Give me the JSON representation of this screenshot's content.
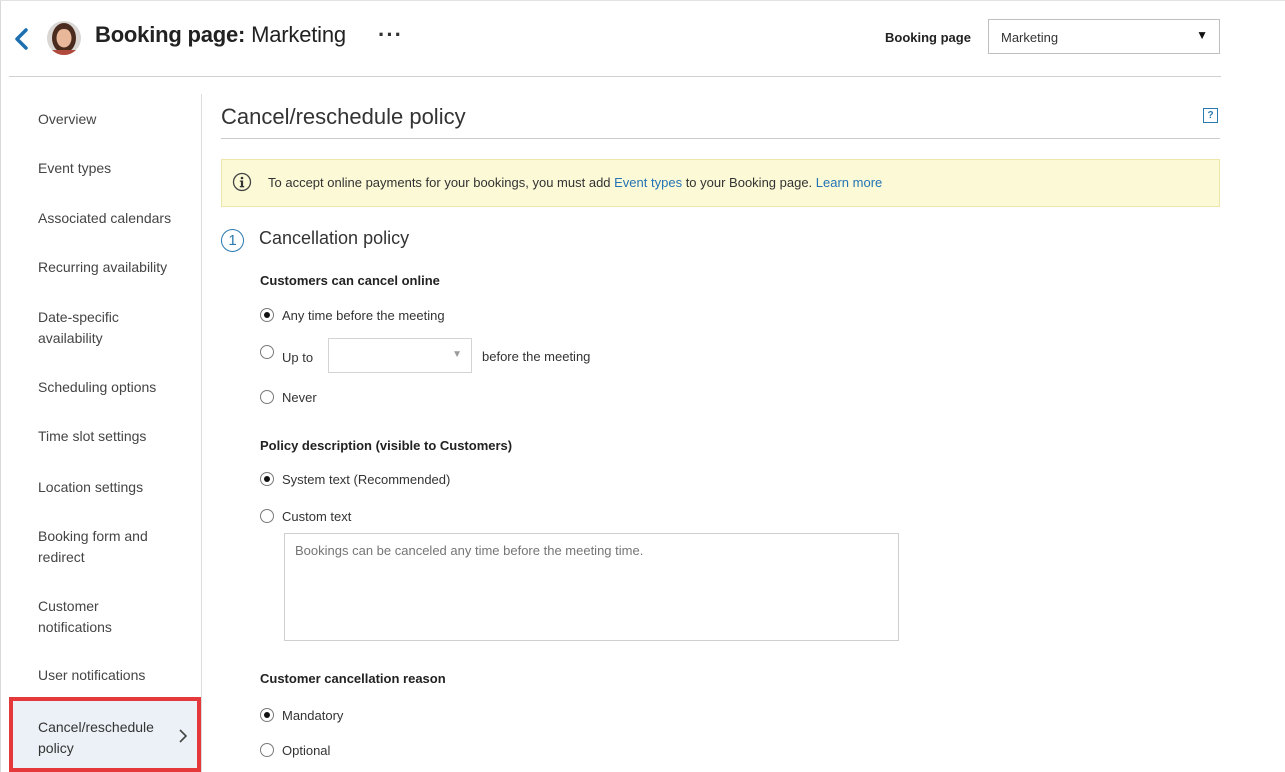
{
  "header": {
    "title_prefix": "Booking page:",
    "title_name": "Marketing",
    "more_label": "···",
    "booking_page_label": "Booking page",
    "booking_page_value": "Marketing"
  },
  "sidebar": {
    "items": [
      {
        "label": "Overview"
      },
      {
        "label": "Event types"
      },
      {
        "label": "Associated calendars"
      },
      {
        "label": "Recurring availability"
      },
      {
        "label": "Date-specific availability"
      },
      {
        "label": "Scheduling options"
      },
      {
        "label": "Time slot settings"
      },
      {
        "label": "Location settings"
      },
      {
        "label": "Booking form and redirect"
      },
      {
        "label": "Customer notifications"
      },
      {
        "label": "User notifications"
      },
      {
        "label": "Cancel/reschedule policy",
        "active": true
      }
    ]
  },
  "main": {
    "title": "Cancel/reschedule policy",
    "help_label": "?",
    "info_banner": {
      "text_before": "To accept online payments for your bookings, you must add ",
      "link1": "Event types",
      "text_middle": " to your Booking page. ",
      "link2": "Learn more"
    },
    "section": {
      "number": "1",
      "title": "Cancellation policy"
    },
    "cancel_online": {
      "label": "Customers can cancel online",
      "options": [
        {
          "label": "Any time before the meeting",
          "checked": true
        },
        {
          "label": "Up to",
          "checked": false
        },
        {
          "label": "Never",
          "checked": false
        }
      ],
      "upto_value": "",
      "upto_after": "before the meeting"
    },
    "policy_description": {
      "label": "Policy description (visible to Customers)",
      "options": [
        {
          "label": "System text (Recommended)",
          "checked": true
        },
        {
          "label": "Custom text",
          "checked": false
        }
      ],
      "textarea_placeholder": "Bookings can be canceled any time before the meeting time."
    },
    "cancellation_reason": {
      "label": "Customer cancellation reason",
      "options": [
        {
          "label": "Mandatory",
          "checked": true
        },
        {
          "label": "Optional",
          "checked": false
        }
      ]
    }
  },
  "colors": {
    "accent": "#2374b6",
    "highlight": "#e5383b",
    "banner_bg": "#fcf9d6",
    "active_bg": "#ebf1f6"
  }
}
